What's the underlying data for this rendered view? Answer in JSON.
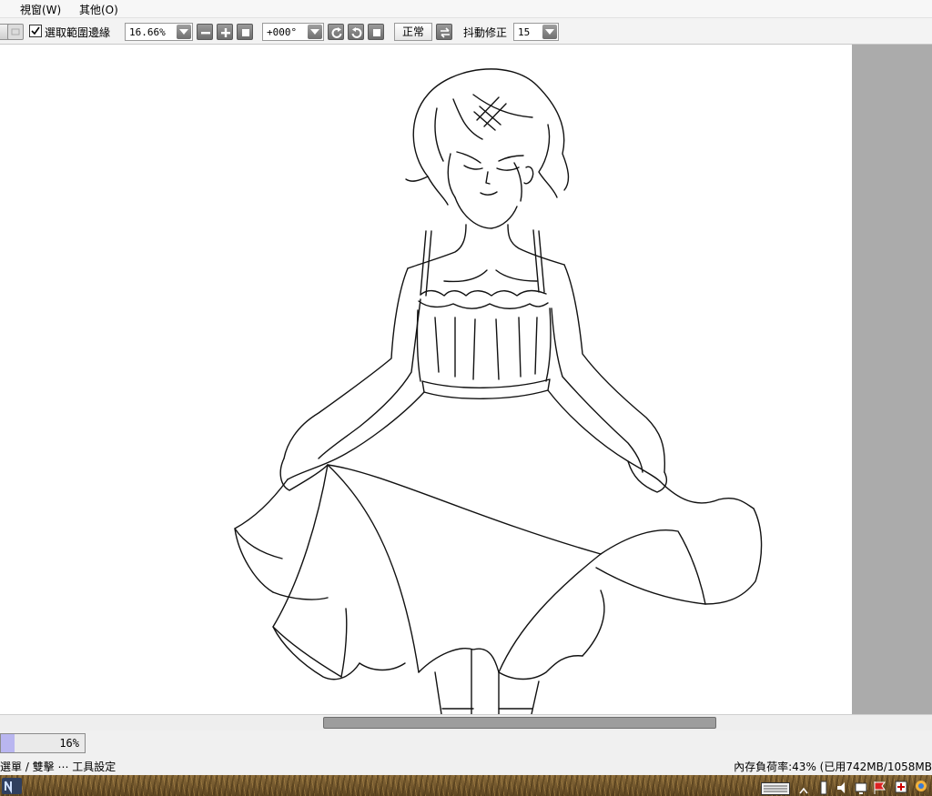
{
  "menu": {
    "items": [
      {
        "label": "視窗(W)"
      },
      {
        "label": "其他(O)"
      }
    ]
  },
  "toolbar": {
    "selection_border_checked": true,
    "selection_border_label": "選取範圍邊緣",
    "zoom_value": "16.66%",
    "rotation_value": "+000°",
    "flip_mode_label": "正常",
    "stabilizer_label": "抖動修正",
    "stabilizer_value": "15"
  },
  "progress": {
    "percent": 16,
    "label": "16%"
  },
  "status": {
    "left_text": "選單 / 雙擊 ⋯ 工具設定",
    "memory_text": "內存負荷率:43% (已用742MB/1058MB"
  },
  "colors": {
    "paper": "#ffffff",
    "workspace": "#ababab",
    "progress_fill": "#b9b6f0"
  }
}
